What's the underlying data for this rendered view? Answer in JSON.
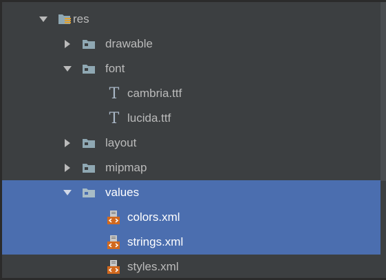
{
  "tree": {
    "res": {
      "label": "res",
      "expanded": true,
      "icon": "resource-folder-icon"
    },
    "drawable": {
      "label": "drawable",
      "expanded": false,
      "icon": "folder-icon"
    },
    "font": {
      "label": "font",
      "expanded": true,
      "icon": "folder-icon"
    },
    "cambria": {
      "label": "cambria.ttf",
      "icon": "font-file-icon"
    },
    "lucida": {
      "label": "lucida.ttf",
      "icon": "font-file-icon"
    },
    "layout": {
      "label": "layout",
      "expanded": false,
      "icon": "folder-icon"
    },
    "mipmap": {
      "label": "mipmap",
      "expanded": false,
      "icon": "folder-icon"
    },
    "values": {
      "label": "values",
      "expanded": true,
      "selected": true,
      "icon": "folder-icon"
    },
    "colors": {
      "label": "colors.xml",
      "selected": true,
      "icon": "xml-file-icon"
    },
    "strings": {
      "label": "strings.xml",
      "selected": true,
      "icon": "xml-file-icon"
    },
    "styles": {
      "label": "styles.xml",
      "selected": false,
      "icon": "xml-file-icon"
    }
  },
  "font_glyph": "T",
  "colors": {
    "background": "#3c3f41",
    "selection": "#4b6eaf",
    "text": "#bbbbbb",
    "folder": "#8fa8b3",
    "xml_icon": "#d2691e"
  }
}
